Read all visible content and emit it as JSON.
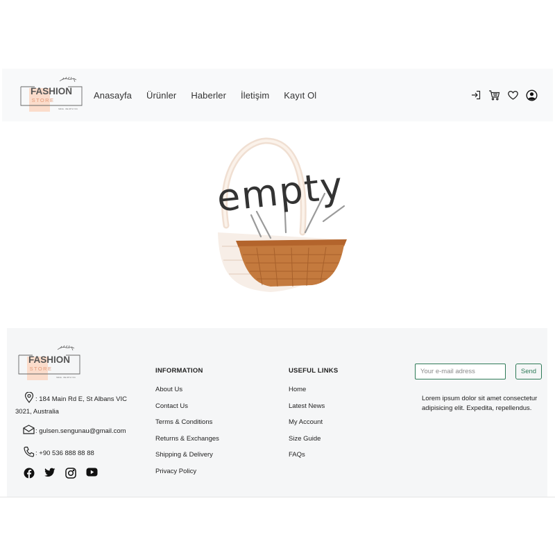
{
  "brand": {
    "logo_text": "FASHION",
    "logo_subtext": "STORE",
    "logo_tagline": "SINCE · WE WITH YOU"
  },
  "nav": {
    "items": [
      {
        "label": "Anasayfa"
      },
      {
        "label": "Ürünler"
      },
      {
        "label": "Haberler"
      },
      {
        "label": "İletişim"
      },
      {
        "label": "Kayıt Ol"
      }
    ]
  },
  "header_icons": [
    "login-icon",
    "cart-icon",
    "heart-icon",
    "user-circle-icon"
  ],
  "empty_cart": {
    "text": "empty"
  },
  "footer": {
    "address": ": 184 Main Rd E, St Albans VIC 3021, Australia",
    "email": ": gulsen.sengunau@gmail.com",
    "phone": ": +90 536 888 88 88",
    "socials": [
      "facebook-icon",
      "twitter-icon",
      "instagram-icon",
      "youtube-icon"
    ],
    "information": {
      "title": "INFORMATION",
      "links": [
        {
          "label": "About Us"
        },
        {
          "label": "Contact Us"
        },
        {
          "label": "Terms & Conditions"
        },
        {
          "label": "Returns & Exchanges"
        },
        {
          "label": "Shipping & Delivery"
        },
        {
          "label": "Privacy Policy"
        }
      ]
    },
    "useful_links": {
      "title": "USEFUL LINKS",
      "links": [
        {
          "label": "Home"
        },
        {
          "label": "Latest News"
        },
        {
          "label": "My Account"
        },
        {
          "label": "Size Guide"
        },
        {
          "label": "FAQs"
        }
      ]
    },
    "newsletter": {
      "placeholder": "Your e-mail adress",
      "value": "",
      "button_label": "Send",
      "description": "Lorem ipsum dolor sit amet consectetur adipisicing elit. Expedita, repellendus."
    }
  },
  "colors": {
    "accent_green": "#2d7a57",
    "header_bg": "#f8f9fa",
    "footer_bg": "#f5f6f7",
    "logo_peach": "#fbdccb",
    "basket_brown": "#c47a3e"
  }
}
